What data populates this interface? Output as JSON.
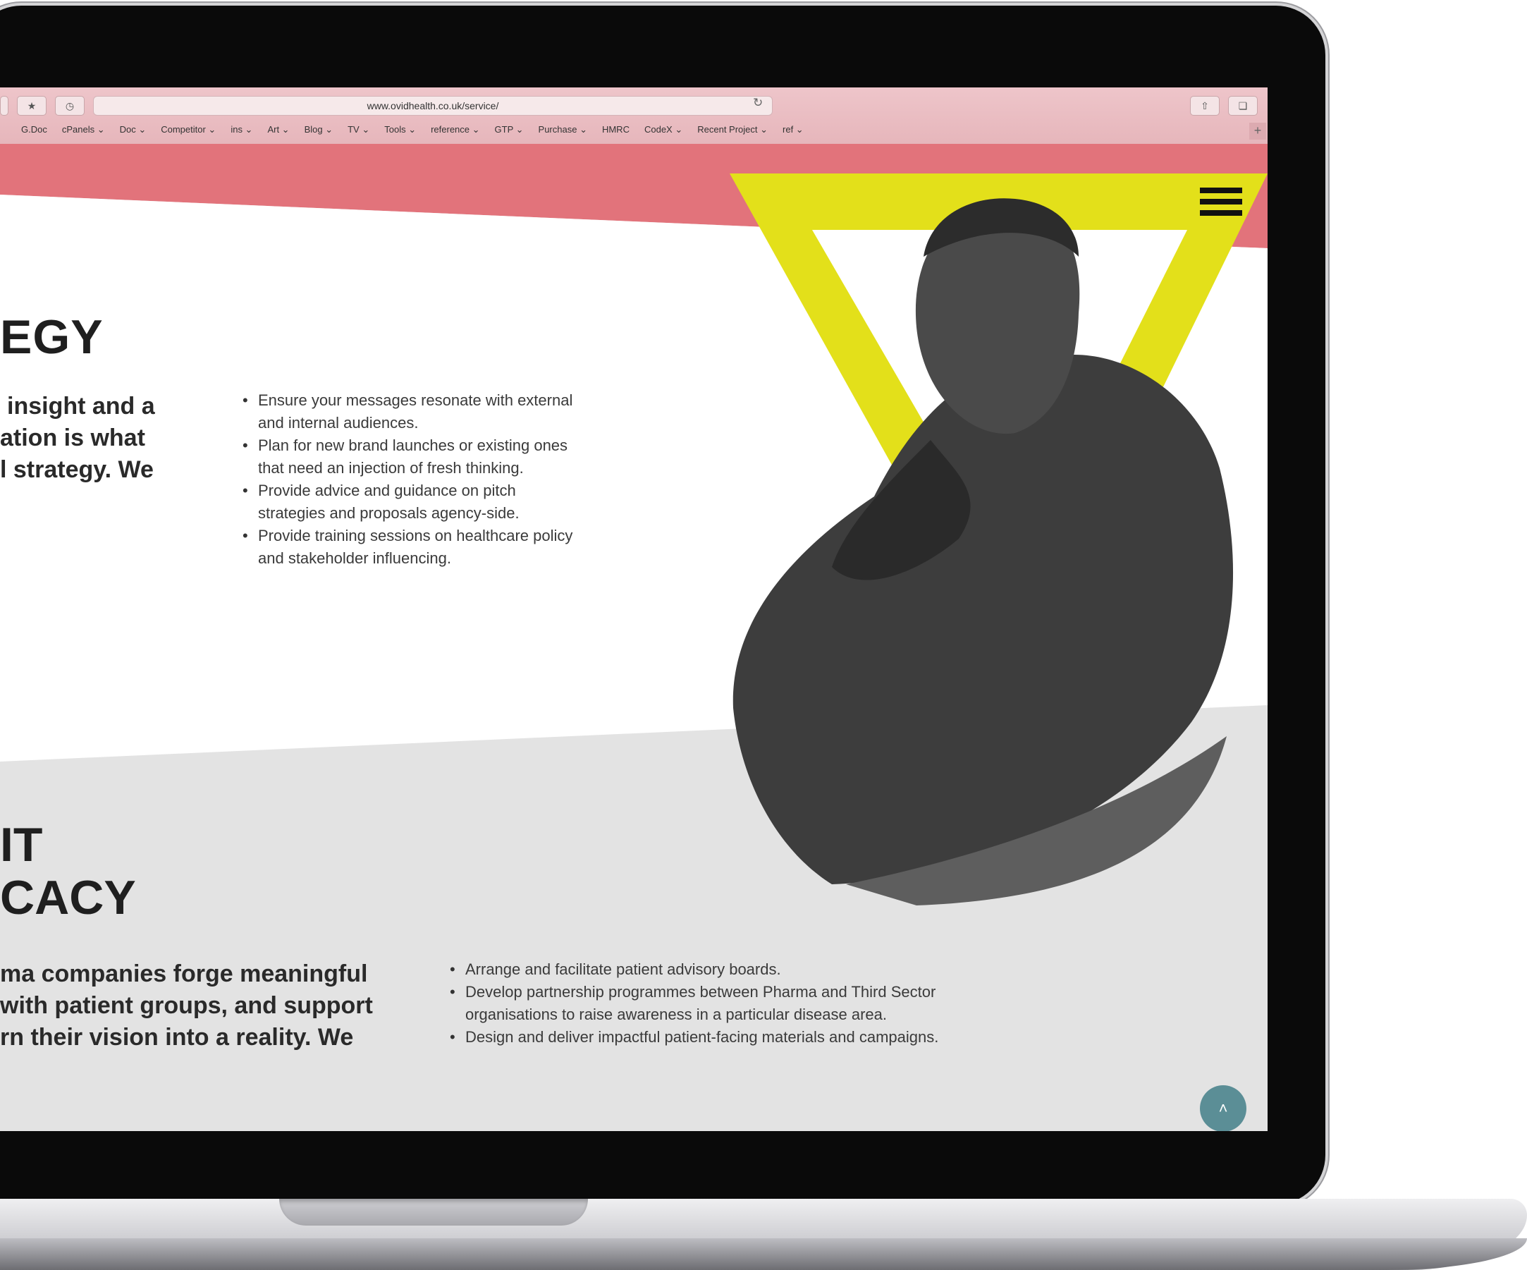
{
  "browser": {
    "url": "www.ovidhealth.co.uk/service/",
    "bookmarks": [
      "G.Doc",
      "cPanels ⌄",
      "Doc ⌄",
      "Competitor ⌄",
      "ins ⌄",
      "Art ⌄",
      "Blog ⌄",
      "TV ⌄",
      "Tools ⌄",
      "reference ⌄",
      "GTP ⌄",
      "Purchase ⌄",
      "HMRC",
      "CodeX ⌄",
      "Recent Project ⌄",
      "ref ⌄"
    ]
  },
  "section1": {
    "heading": "EGY",
    "lead": [
      "insight and a",
      "ation is what",
      "l strategy. We"
    ],
    "bullets": [
      [
        "Ensure your messages resonate with external",
        "and internal audiences."
      ],
      [
        "Plan for new brand launches or existing ones",
        "that need an injection of fresh thinking."
      ],
      [
        "Provide advice and guidance on pitch",
        "strategies and proposals agency-side."
      ],
      [
        "Provide training sessions on healthcare policy",
        "and stakeholder influencing."
      ]
    ]
  },
  "section2": {
    "heading_line1": "IT",
    "heading_line2": "CACY",
    "lead": [
      "ma companies forge meaningful",
      "with patient groups, and support",
      "rn their vision into a reality. We"
    ],
    "bullets": [
      [
        "Arrange and facilitate patient advisory boards."
      ],
      [
        "Develop partnership programmes between Pharma and Third Sector",
        "organisations to raise awareness in a particular disease area."
      ],
      [
        "Design and deliver impactful patient-facing materials and campaigns."
      ]
    ]
  },
  "colors": {
    "pink": "#e2737b",
    "yellow": "#e3e01a",
    "teal": "#5b8e96"
  },
  "icons": {
    "menu": "hamburger-icon",
    "back_to_top": "chevron-up-icon"
  }
}
